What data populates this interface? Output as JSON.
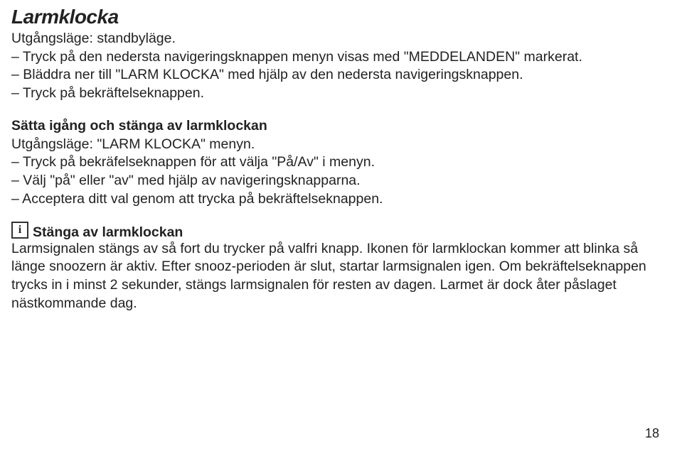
{
  "title": "Larmklocka",
  "intro": {
    "line1": "Utgångsläge: standbyläge.",
    "line2": "– Tryck på den nedersta navigeringsknappen menyn visas med \"MEDDELANDEN\" markerat.",
    "line3": "– Bläddra ner till \"LARM KLOCKA\" med hjälp av den nedersta navigeringsknappen.",
    "line4": "– Tryck på bekräftelseknappen."
  },
  "section1": {
    "heading": "Sätta igång och stänga av larmklockan",
    "line1": "Utgångsläge: \"LARM KLOCKA\" menyn.",
    "line2": "– Tryck på bekräfelseknappen för att välja \"På/Av\" i menyn.",
    "line3": "– Välj \"på\" eller \"av\" med hjälp av navigeringsknapparna.",
    "line4": "– Acceptera ditt val genom att trycka på bekräftelseknappen."
  },
  "info": {
    "icon_glyph": "i",
    "heading": "Stänga av larmklockan",
    "body": "Larmsignalen stängs av så fort du trycker på valfri knapp. Ikonen för larmklockan kommer att blinka så länge snoozern är aktiv. Efter snooz-perioden är slut, startar larmsignalen igen. Om bekräftelseknappen trycks in i minst 2 sekunder, stängs larmsignalen för resten av dagen. Larmet är dock åter påslaget nästkommande dag."
  },
  "page_number": "18"
}
